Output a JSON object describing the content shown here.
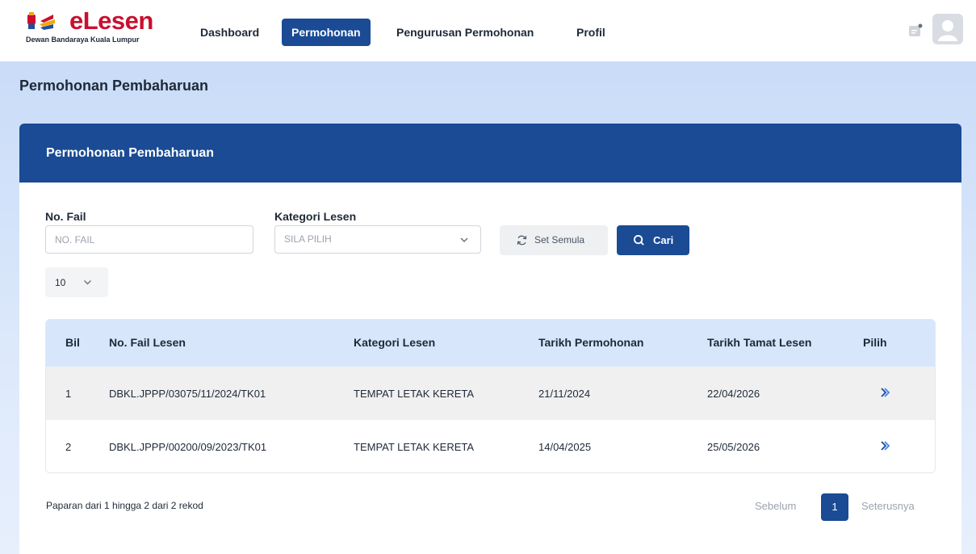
{
  "brand": {
    "name": "eLesen",
    "subtitle": "Dewan Bandaraya Kuala Lumpur",
    "logo_colors": [
      "#c8102e",
      "#f2a900",
      "#1f4fa0"
    ]
  },
  "nav": {
    "items": [
      {
        "label": "Dashboard",
        "active": false
      },
      {
        "label": "Permohonan",
        "active": true
      },
      {
        "label": "Pengurusan Permohonan",
        "active": false
      },
      {
        "label": "Profil",
        "active": false
      }
    ]
  },
  "header": {
    "notification_icon": "notification-icon",
    "avatar_icon": "user-avatar-icon"
  },
  "page": {
    "title": "Permohonan Pembaharuan"
  },
  "card": {
    "title": "Permohonan Pembaharuan"
  },
  "filters": {
    "no_fail_label": "No. Fail",
    "no_fail_placeholder": "NO. FAIL",
    "kategori_label": "Kategori Lesen",
    "kategori_placeholder": "SILA PILIH",
    "reset_label": "Set Semula",
    "search_label": "Cari",
    "page_size": "10"
  },
  "table": {
    "columns": [
      "Bil",
      "No. Fail Lesen",
      "Kategori Lesen",
      "Tarikh Permohonan",
      "Tarikh Tamat Lesen",
      "Pilih"
    ],
    "rows": [
      {
        "bil": "1",
        "no_fail": "DBKL.JPPP/03075/11/2024/TK01",
        "kategori": "TEMPAT LETAK KERETA",
        "tarikh_permohonan": "21/11/2024",
        "tarikh_tamat": "22/04/2026"
      },
      {
        "bil": "2",
        "no_fail": "DBKL.JPPP/00200/09/2023/TK01",
        "kategori": "TEMPAT LETAK KERETA",
        "tarikh_permohonan": "14/04/2025",
        "tarikh_tamat": "25/05/2026"
      }
    ]
  },
  "pagination": {
    "summary": "Paparan dari 1 hingga 2 dari 2 rekod",
    "prev": "Sebelum",
    "current": "1",
    "next": "Seterusnya"
  },
  "colors": {
    "primary": "#1a4b94",
    "table_header": "#d7e6fb",
    "row_alt": "#f0f0f0"
  }
}
